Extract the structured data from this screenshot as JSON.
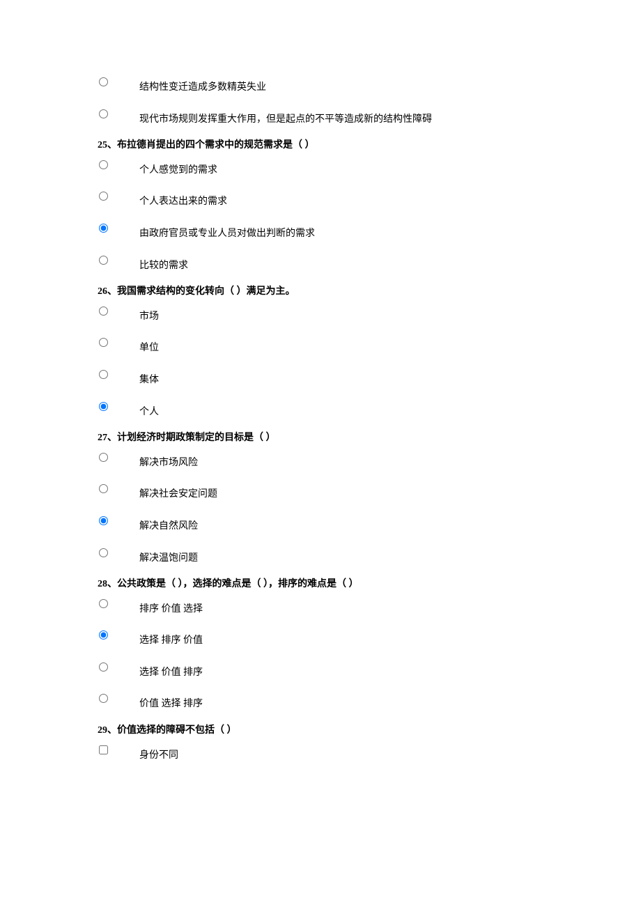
{
  "orphan_options": [
    {
      "text": "结构性变迁造成多数精英失业",
      "checked": false
    },
    {
      "text": "现代市场规则发挥重大作用，但是起点的不平等造成新的结构性障碍",
      "checked": false
    }
  ],
  "questions": [
    {
      "title": "25、布拉德肖提出的四个需求中的规范需求是（ ）",
      "type": "radio",
      "name": "q25",
      "options": [
        {
          "text": "个人感觉到的需求",
          "checked": false
        },
        {
          "text": "个人表达出来的需求",
          "checked": false
        },
        {
          "text": "由政府官员或专业人员对做出判断的需求",
          "checked": true
        },
        {
          "text": "比较的需求",
          "checked": false
        }
      ]
    },
    {
      "title": "26、我国需求结构的变化转向（ ）满足为主。",
      "type": "radio",
      "name": "q26",
      "options": [
        {
          "text": "市场",
          "checked": false
        },
        {
          "text": "单位",
          "checked": false
        },
        {
          "text": "集体",
          "checked": false
        },
        {
          "text": "个人",
          "checked": true
        }
      ]
    },
    {
      "title": "27、计划经济时期政策制定的目标是（ ）",
      "type": "radio",
      "name": "q27",
      "options": [
        {
          "text": "解决市场风险",
          "checked": false
        },
        {
          "text": "解决社会安定问题",
          "checked": false
        },
        {
          "text": "解决自然风险",
          "checked": true
        },
        {
          "text": "解决温饱问题",
          "checked": false
        }
      ]
    },
    {
      "title": "28、公共政策是（ ），选择的难点是（ ），排序的难点是（ ）",
      "type": "radio",
      "name": "q28",
      "options": [
        {
          "text": "排序  价值  选择",
          "checked": false
        },
        {
          "text": "选择  排序  价值",
          "checked": true
        },
        {
          "text": "选择  价值  排序",
          "checked": false
        },
        {
          "text": "价值  选择  排序",
          "checked": false
        }
      ]
    },
    {
      "title": "29、价值选择的障碍不包括（ ）",
      "type": "checkbox",
      "name": "q29",
      "options": [
        {
          "text": "身份不同",
          "checked": false
        }
      ]
    }
  ]
}
